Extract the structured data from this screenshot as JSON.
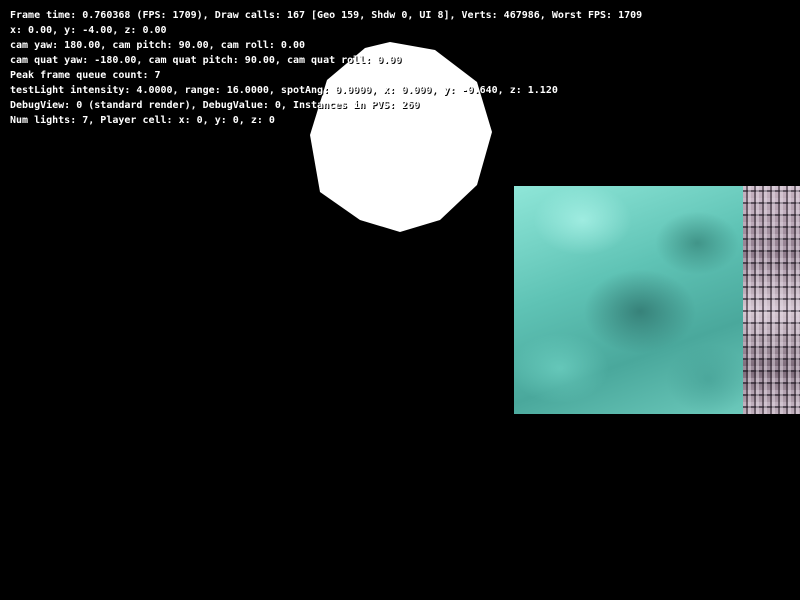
{
  "hud": {
    "lines": [
      "Frame time: 0.760368 (FPS: 1709), Draw calls: 167 [Geo 159, Shdw 0, UI 8], Verts: 467986, Worst FPS: 1709",
      "x: 0.00, y: -4.00, z: 0.00",
      "cam yaw: 180.00, cam pitch: 90.00, cam roll: 0.00",
      "cam quat yaw: -180.00, cam quat pitch: 90.00, cam quat roll: 0.00",
      "Peak frame queue count: 7",
      "testLight intensity: 4.0000, range: 16.0000, spotAng: 0.0000, x: 0.000, y: -0.640, z: 1.120",
      "DebugView: 0 (standard render), DebugValue: 0, Instances in PVS: 260",
      "Num lights: 7, Player cell: x: 0, y: 0, z: 0"
    ]
  },
  "colors": {
    "background": "#000000",
    "hud_text": "#ffffff",
    "light_disc": "#ffffff",
    "cyan_texture": "#6cc9bb",
    "tech_texture": "#b8a6b4"
  }
}
